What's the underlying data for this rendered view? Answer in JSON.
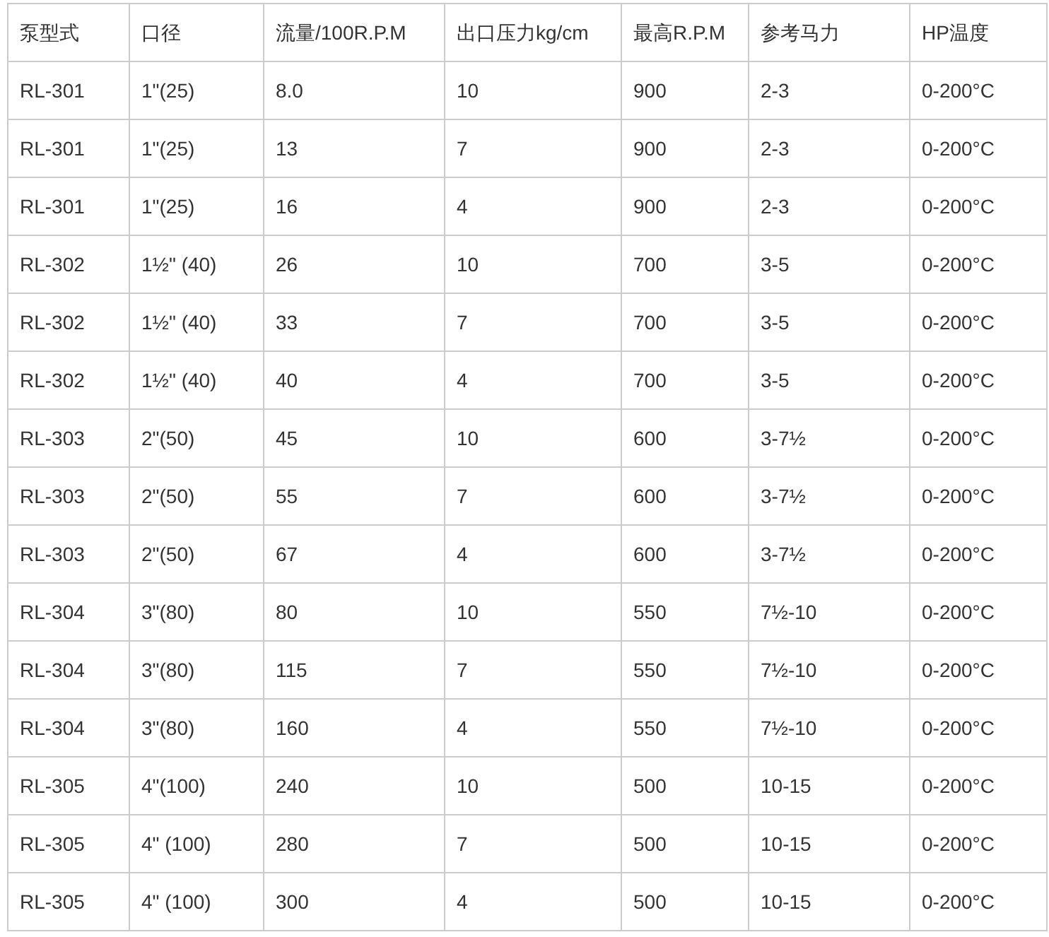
{
  "table": {
    "columns": [
      "泵型式",
      "口径",
      "流量/100R.P.M",
      "出口压力kg/cm",
      "最高R.P.M",
      "参考马力",
      "HP温度"
    ],
    "rows": [
      [
        "RL-301",
        "1\"(25)",
        "8.0",
        "10",
        "900",
        "2-3",
        "0-200°C"
      ],
      [
        "RL-301",
        "1\"(25)",
        "13",
        "7",
        "900",
        "2-3",
        "0-200°C"
      ],
      [
        "RL-301",
        "1\"(25)",
        "16",
        "4",
        "900",
        "2-3",
        "0-200°C"
      ],
      [
        "RL-302",
        "1½\" (40)",
        "26",
        "10",
        "700",
        "3-5",
        "0-200°C"
      ],
      [
        "RL-302",
        "1½\" (40)",
        "33",
        "7",
        "700",
        "3-5",
        "0-200°C"
      ],
      [
        "RL-302",
        "1½\" (40)",
        "40",
        "4",
        "700",
        "3-5",
        "0-200°C"
      ],
      [
        "RL-303",
        "2\"(50)",
        "45",
        "10",
        "600",
        "3-7½",
        "0-200°C"
      ],
      [
        "RL-303",
        "2\"(50)",
        "55",
        "7",
        "600",
        "3-7½",
        "0-200°C"
      ],
      [
        "RL-303",
        "2\"(50)",
        "67",
        "4",
        "600",
        "3-7½",
        "0-200°C"
      ],
      [
        "RL-304",
        "3\"(80)",
        "80",
        "10",
        "550",
        "7½-10",
        "0-200°C"
      ],
      [
        "RL-304",
        "3\"(80)",
        "115",
        "7",
        "550",
        "7½-10",
        "0-200°C"
      ],
      [
        "RL-304",
        "3\"(80)",
        "160",
        "4",
        "550",
        "7½-10",
        "0-200°C"
      ],
      [
        "RL-305",
        "4\"(100)",
        "240",
        "10",
        "500",
        "10-15",
        "0-200°C"
      ],
      [
        "RL-305",
        "4\" (100)",
        "280",
        "7",
        "500",
        "10-15",
        "0-200°C"
      ],
      [
        "RL-305",
        "4\" (100)",
        "300",
        "4",
        "500",
        "10-15",
        "0-200°C"
      ]
    ]
  }
}
